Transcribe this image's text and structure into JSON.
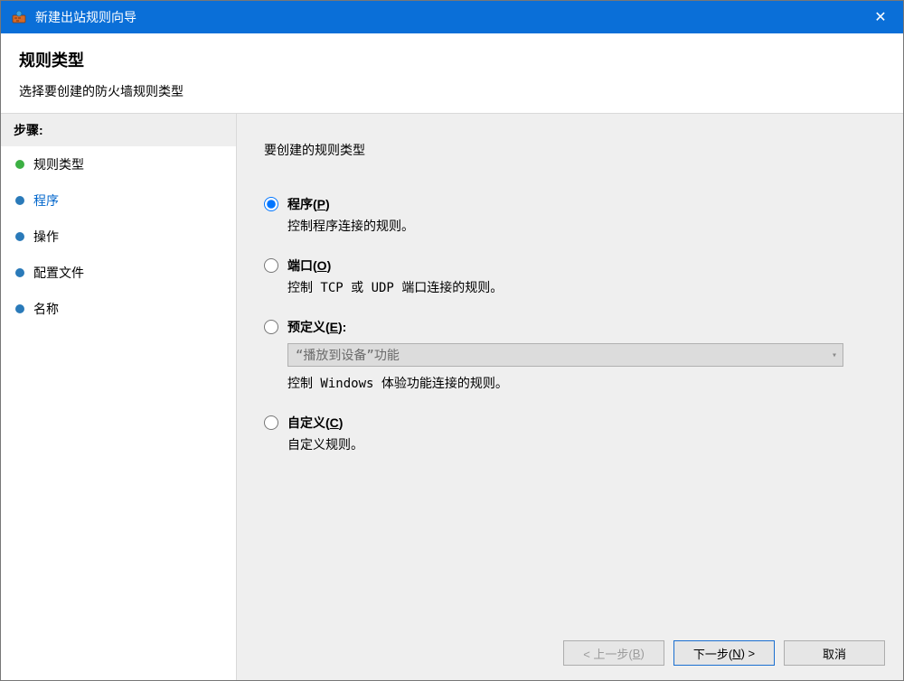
{
  "titlebar": {
    "title": "新建出站规则向导"
  },
  "header": {
    "title": "规则类型",
    "subtitle": "选择要创建的防火墙规则类型"
  },
  "sidebar": {
    "steps_header": "步骤:",
    "items": [
      {
        "label": "规则类型"
      },
      {
        "label": "程序"
      },
      {
        "label": "操作"
      },
      {
        "label": "配置文件"
      },
      {
        "label": "名称"
      }
    ]
  },
  "main": {
    "prompt": "要创建的规则类型",
    "options": [
      {
        "key": "program",
        "label_pre": "程序(",
        "hotkey": "P",
        "label_post": ")",
        "desc": "控制程序连接的规则。",
        "checked": true
      },
      {
        "key": "port",
        "label_pre": "端口(",
        "hotkey": "O",
        "label_post": ")",
        "desc": "控制 TCP 或 UDP 端口连接的规则。",
        "checked": false
      },
      {
        "key": "predefined",
        "label_pre": "预定义(",
        "hotkey": "E",
        "label_post": "):",
        "desc": "控制 Windows 体验功能连接的规则。",
        "checked": false,
        "dropdown": "“播放到设备”功能"
      },
      {
        "key": "custom",
        "label_pre": "自定义(",
        "hotkey": "C",
        "label_post": ")",
        "desc": "自定义规则。",
        "checked": false
      }
    ]
  },
  "footer": {
    "back_pre": "< 上一步(",
    "back_hotkey": "B",
    "back_post": ")",
    "next_pre": "下一步(",
    "next_hotkey": "N",
    "next_post": ") >",
    "cancel": "取消"
  }
}
